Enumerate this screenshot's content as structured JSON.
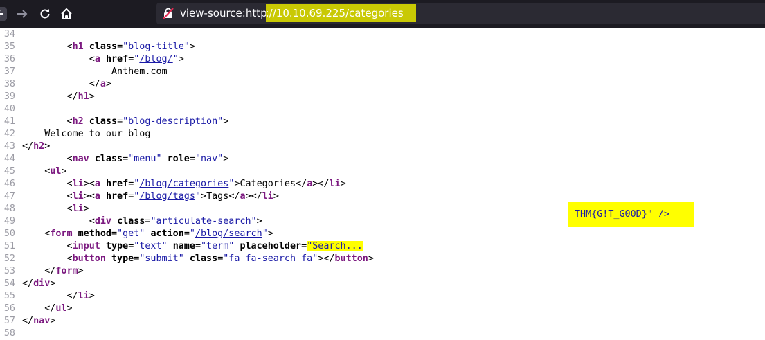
{
  "browser": {
    "url_prefix": "view-source:http",
    "url_host": "://10.10.69.225/categories"
  },
  "source_lines": [
    {
      "n": "34"
    },
    {
      "n": "35",
      "a": "        <",
      "b": "h1",
      "c": " ",
      "d": "class",
      "e": "=\"",
      "f": "blog-title",
      "g": "\">"
    },
    {
      "n": "36",
      "a": "            <",
      "b": "a",
      "c": " ",
      "d": "href",
      "e": "=\"",
      "f": "/blog/",
      "g": "\">"
    },
    {
      "n": "37",
      "t": "                Anthem.com"
    },
    {
      "n": "38",
      "t": "            </a>"
    },
    {
      "n": "39",
      "t": "        </h1>"
    },
    {
      "n": "40"
    },
    {
      "n": "41",
      "a": "        <",
      "b": "h2",
      "c": " ",
      "d": "class",
      "e": "=\"",
      "f": "blog-description",
      "g": "\">"
    },
    {
      "n": "42",
      "t": "    Welcome to our blog"
    },
    {
      "n": "43",
      "t": "</h2>"
    },
    {
      "n": "44",
      "a": "        <",
      "b": "nav",
      "c": " ",
      "d": "class",
      "e": "=\"",
      "f": "menu",
      "g": "\" role=\"nav\">"
    },
    {
      "n": "45",
      "t": "    <ul>"
    },
    {
      "n": "46",
      "t": "        <li><a href=\"/blog/categories\">Categories</a></li>"
    },
    {
      "n": "47",
      "t": "        <li><a href=\"/blog/tags\">Tags</a></li>"
    },
    {
      "n": "48",
      "t": "        <li>"
    },
    {
      "n": "49",
      "t": "            <div class=\"articulate-search\">"
    },
    {
      "n": "50",
      "t": "    <form method=\"get\" action=\"/blog/search\">"
    },
    {
      "n": "51",
      "t": "        <input type=\"text\" name=\"term\" placeholder=\"Search..."
    },
    {
      "n": "52",
      "t": "        <button type=\"submit\" class=\"fa fa-search fa\"></button>"
    },
    {
      "n": "53",
      "t": "    </form>"
    },
    {
      "n": "54",
      "t": "</div>"
    },
    {
      "n": "55",
      "t": "        </li>"
    },
    {
      "n": "56",
      "t": "    </ul>"
    },
    {
      "n": "57",
      "t": "</nav>"
    },
    {
      "n": "58"
    }
  ],
  "flag": "THM{G!T_G00D}\" />"
}
